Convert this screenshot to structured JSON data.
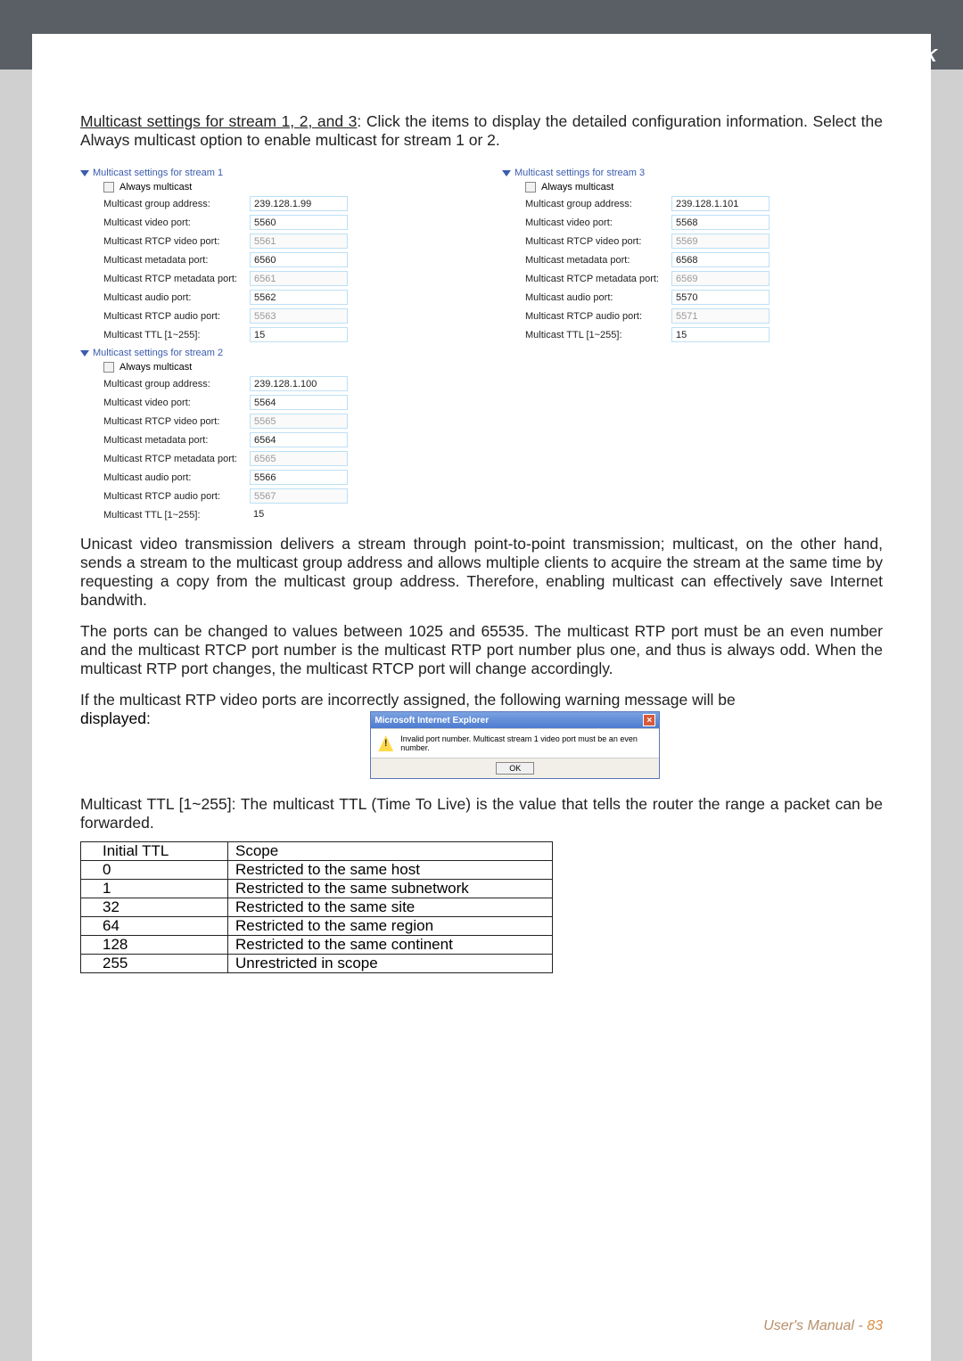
{
  "brand": "VIVOTEK",
  "intro": {
    "lead": "Multicast settings for stream 1, 2, and 3",
    "rest": ": Click the items to display the detailed configuration information. Select the Always multicast option to enable multicast for stream 1 or 2."
  },
  "sections": {
    "s1": {
      "title": "Multicast settings for stream 1",
      "always": "Always multicast",
      "rows": [
        {
          "l": "Multicast group address:",
          "v": "239.128.1.99",
          "ro": false
        },
        {
          "l": "Multicast video port:",
          "v": "5560",
          "ro": false
        },
        {
          "l": "Multicast RTCP video port:",
          "v": "5561",
          "ro": true
        },
        {
          "l": "Multicast metadata port:",
          "v": "6560",
          "ro": false
        },
        {
          "l": "Multicast RTCP metadata port:",
          "v": "6561",
          "ro": true
        },
        {
          "l": "Multicast audio port:",
          "v": "5562",
          "ro": false
        },
        {
          "l": "Multicast RTCP audio port:",
          "v": "5563",
          "ro": true
        },
        {
          "l": "Multicast TTL [1~255]:",
          "v": "15",
          "ro": false
        }
      ]
    },
    "s2": {
      "title": "Multicast settings for stream 2",
      "always": "Always multicast",
      "rows": [
        {
          "l": "Multicast group address:",
          "v": "239.128.1.100",
          "ro": false
        },
        {
          "l": "Multicast video port:",
          "v": "5564",
          "ro": false
        },
        {
          "l": "Multicast RTCP video port:",
          "v": "5565",
          "ro": true
        },
        {
          "l": "Multicast metadata port:",
          "v": "6564",
          "ro": false
        },
        {
          "l": "Multicast RTCP metadata port:",
          "v": "6565",
          "ro": true
        },
        {
          "l": "Multicast audio port:",
          "v": "5566",
          "ro": false
        },
        {
          "l": "Multicast RTCP audio port:",
          "v": "5567",
          "ro": true
        },
        {
          "l": "Multicast TTL [1~255]:",
          "v": "15",
          "plain": true
        }
      ]
    },
    "s3": {
      "title": "Multicast settings for stream 3",
      "always": "Always multicast",
      "rows": [
        {
          "l": "Multicast group address:",
          "v": "239.128.1.101",
          "ro": false
        },
        {
          "l": "Multicast video port:",
          "v": "5568",
          "ro": false
        },
        {
          "l": "Multicast RTCP video port:",
          "v": "5569",
          "ro": true
        },
        {
          "l": "Multicast metadata port:",
          "v": "6568",
          "ro": false
        },
        {
          "l": "Multicast RTCP metadata port:",
          "v": "6569",
          "ro": true
        },
        {
          "l": "Multicast audio port:",
          "v": "5570",
          "ro": false
        },
        {
          "l": "Multicast RTCP audio port:",
          "v": "5571",
          "ro": true
        },
        {
          "l": "Multicast TTL [1~255]:",
          "v": "15",
          "ro": false
        }
      ]
    }
  },
  "para1": "Unicast video transmission delivers a stream through point-to-point transmission; multicast, on the other hand, sends a stream to the multicast group address and allows multiple clients to acquire the stream at the same time by requesting a copy from the multicast group address. Therefore, enabling multicast can effectively save Internet bandwith.",
  "para2": "The ports can be changed to values between 1025 and 65535. The multicast RTP port must be an even number and the multicast RTCP port number is the multicast RTP port number plus one, and thus is always odd. When the multicast RTP port changes, the multicast RTCP port will change accordingly.",
  "para3a": "If the multicast RTP video ports are incorrectly assigned, the following warning message will be",
  "para3b": "displayed:",
  "dialog": {
    "title": "Microsoft Internet Explorer",
    "msg": "Invalid port number. Multicast stream 1 video port must be an even number.",
    "ok": "OK",
    "bang": "!"
  },
  "para4": {
    "lead": "Multicast TTL [1~255]",
    "rest": ": The multicast TTL (Time To Live) is the value that tells the router the range a packet can be forwarded."
  },
  "ttl": {
    "h1": "Initial TTL",
    "h2": "Scope",
    "rows": [
      {
        "a": "0",
        "b": "Restricted to the same host"
      },
      {
        "a": "1",
        "b": "Restricted to the same subnetwork"
      },
      {
        "a": "32",
        "b": "Restricted to the same site"
      },
      {
        "a": "64",
        "b": "Restricted to the same region"
      },
      {
        "a": "128",
        "b": "Restricted to the same continent"
      },
      {
        "a": "255",
        "b": "Unrestricted in scope"
      }
    ]
  },
  "footer": {
    "label": "User's Manual - ",
    "page": "83"
  }
}
